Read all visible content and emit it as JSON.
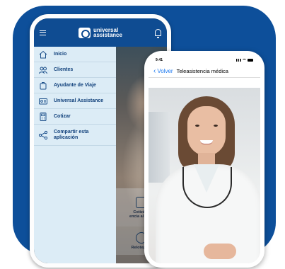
{
  "phone1": {
    "brand": {
      "line1": "universal",
      "line2": "assistance"
    },
    "menu": [
      {
        "label": "Inicio",
        "icon": "home-icon"
      },
      {
        "label": "Clientes",
        "icon": "users-icon"
      },
      {
        "label": "Ayudante de Viaje",
        "icon": "luggage-icon"
      },
      {
        "label": "Universal Assistance",
        "icon": "id-card-icon"
      },
      {
        "label": "Cotizar",
        "icon": "calculator-icon"
      },
      {
        "label": "Compartir esta\naplicación",
        "icon": "share-icon"
      }
    ],
    "cards": {
      "cotiza": "Cotizá tu\nencia al viaje",
      "relo": "Relotegros"
    }
  },
  "phone2": {
    "status_time": "9:41",
    "back_label": "Volver",
    "title": "Teleasistencia médica"
  },
  "colors": {
    "brand_blue": "#0d4f9a",
    "menu_bg": "#dcecf6",
    "ios_link": "#1e7af0"
  }
}
